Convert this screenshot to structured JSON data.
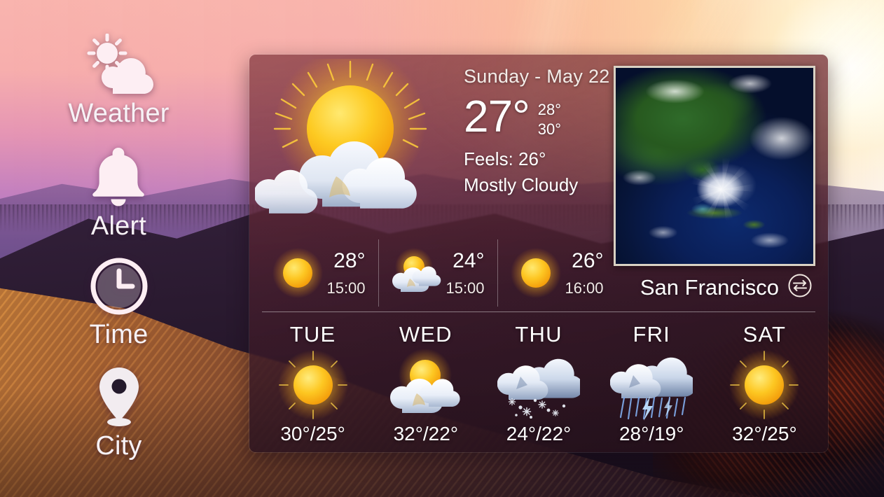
{
  "sidebar": {
    "items": [
      {
        "label": "Weather",
        "icon": "sun-cloud-icon"
      },
      {
        "label": "Alert",
        "icon": "bell-icon"
      },
      {
        "label": "Time",
        "icon": "clock-icon"
      },
      {
        "label": "City",
        "icon": "location-pin-icon"
      }
    ]
  },
  "panel": {
    "current": {
      "date": "Sunday - May 22",
      "temperature": "27°",
      "high": "28°",
      "low": "30°",
      "feels_like": "Feels: 26°",
      "condition": "Mostly Cloudy",
      "icon": "sun-behind-cloud-icon"
    },
    "map": {
      "name": "satellite-map",
      "alt": "Satellite view of eastern North America and the Caribbean with a hurricane"
    },
    "location": {
      "city": "San Francisco",
      "toggle_icon": "unit-swap-icon"
    },
    "hourly": [
      {
        "temp": "28°",
        "time": "15:00",
        "icon": "sun-icon"
      },
      {
        "temp": "24°",
        "time": "15:00",
        "icon": "sun-behind-cloud-icon"
      },
      {
        "temp": "26°",
        "time": "16:00",
        "icon": "sun-icon"
      }
    ],
    "daily": [
      {
        "day": "TUE",
        "temps": "30°/25°",
        "icon": "sun-icon"
      },
      {
        "day": "WED",
        "temps": "32°/22°",
        "icon": "sun-behind-cloud-icon"
      },
      {
        "day": "THU",
        "temps": "24°/22°",
        "icon": "snow-icon"
      },
      {
        "day": "FRI",
        "temps": "28°/19°",
        "icon": "thunderstorm-icon"
      },
      {
        "day": "SAT",
        "temps": "32°/25°",
        "icon": "sun-icon"
      }
    ]
  },
  "colors": {
    "accent_sun": "#ffc41e",
    "panel_overlay": "#4a1f2e",
    "text_primary": "#ffffff"
  }
}
